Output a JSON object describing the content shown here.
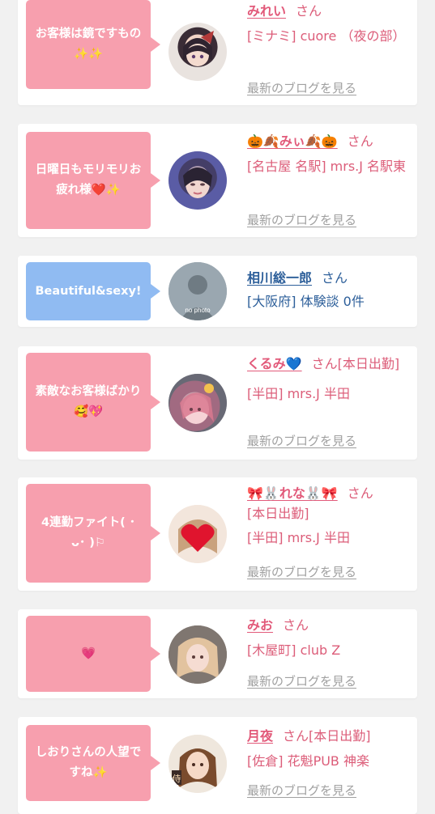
{
  "posts": [
    {
      "message": "お客様は鏡ですもの✨✨",
      "name": "みれい",
      "san": "さん",
      "shop": "[ミナミ] cuore （夜の部）",
      "blog_link": "最新のブログを見る"
    },
    {
      "message": "日曜日もモリモリお疲れ様❤️✨",
      "name": "🎃🍂みぃ🍂🎃",
      "san": "さん",
      "shop": "[名古屋 名駅] mrs.J 名駅東",
      "blog_link": "最新のブログを見る"
    },
    {
      "message": "Beautiful&sexy!",
      "name": "相川総一郎",
      "san": "さん",
      "shop": "[大阪府] 体験談 0件",
      "avatar_text": "no photo"
    },
    {
      "message": "素敵なお客様ばかり🥰💖",
      "name": "くるみ💙",
      "san": "さん[本日出勤]",
      "shop": "[半田] mrs.J 半田",
      "blog_link": "最新のブログを見る"
    },
    {
      "message": "4連勤ファイト( ･ ᴗ･ )⚐",
      "name": "🎀🐰れな🐰🎀",
      "san": "さん",
      "status": "[本日出勤]",
      "shop": "[半田] mrs.J 半田",
      "blog_link": "最新のブログを見る"
    },
    {
      "message": "💗",
      "name": "みお",
      "san": "さん",
      "shop": "[木屋町] club Z",
      "blog_link": "最新のブログを見る"
    },
    {
      "message": "しおりさんの人望ですね✨",
      "name": "月夜",
      "san": "さん[本日出勤]",
      "shop": "[佐倉] 花魁PUB 神楽",
      "blog_link": "最新のブログを見る"
    }
  ],
  "colors": {
    "background": "#f1f1f1",
    "card": "#ffffff",
    "bubble_pink": "#f79fae",
    "bubble_blue": "#90bbf2",
    "name_pink": "#e25a7a",
    "name_blue": "#2d5f9a",
    "link_gray": "#a0a0a0"
  }
}
